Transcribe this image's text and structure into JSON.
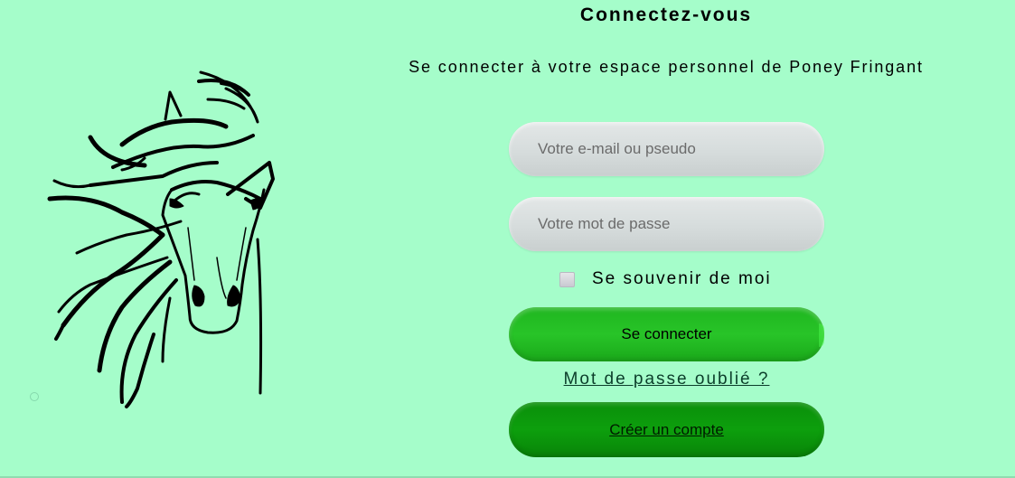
{
  "header": {
    "title": "Connectez-vous",
    "subtitle": "Se connecter à votre espace personnel de Poney Fringant"
  },
  "form": {
    "email_placeholder": "Votre e-mail ou pseudo",
    "password_placeholder": "Votre mot de passe",
    "remember_label": "Se souvenir de moi",
    "login_label": "Se connecter",
    "forgot_label": "Mot de passe oublié ?",
    "create_account_label": "Créer un compte"
  },
  "icons": {
    "logo": "horse-head-icon"
  },
  "colors": {
    "background": "#a5fdca",
    "login_button": "#28c428",
    "create_button": "#0d9f0d",
    "field": "#d6dcdc"
  }
}
